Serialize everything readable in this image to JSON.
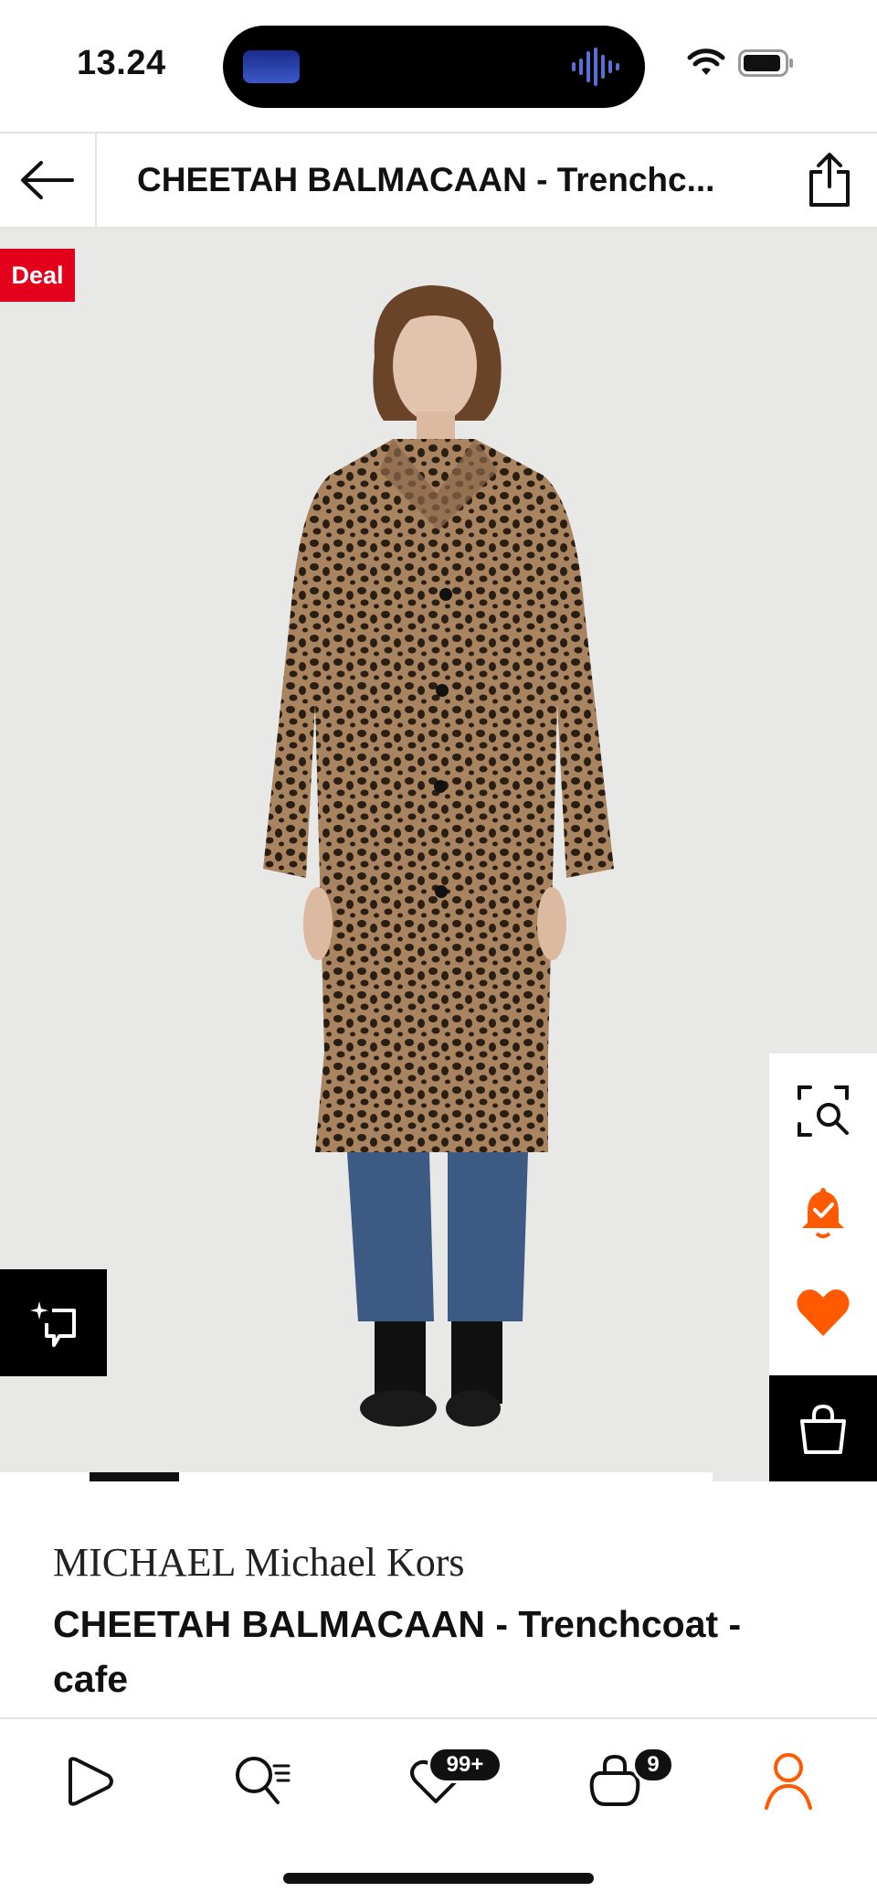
{
  "status_bar": {
    "time": "13.24"
  },
  "header": {
    "title": "CHEETAH BALMACAAN  - Trenchc..."
  },
  "product": {
    "deal_badge": "Deal",
    "brand": "MICHAEL Michael Kors",
    "name": "CHEETAH BALMACAAN  - Trenchcoat - cafe",
    "image_alt": "Model wearing a cheetah print trenchcoat"
  },
  "carousel": {
    "current_index": 2,
    "total_visible_segments": 8
  },
  "bottom_nav": {
    "wishlist_badge": "99+",
    "cart_badge": "9"
  },
  "colors": {
    "accent": "#ff5a00",
    "deal_red": "#e3001b",
    "image_background": "#e8e8e7"
  },
  "icons": {
    "back": "arrow-left-icon",
    "share": "share-icon",
    "visual_search": "visual-search-icon",
    "alert": "bell-check-icon",
    "favorite": "heart-icon",
    "bag": "shopping-bag-icon",
    "ai": "sparkle-icon",
    "nav_home": "play-icon",
    "nav_search": "search-list-icon",
    "nav_wishlist": "heart-outline-icon",
    "nav_cart": "bag-outline-icon",
    "nav_profile": "profile-icon"
  }
}
